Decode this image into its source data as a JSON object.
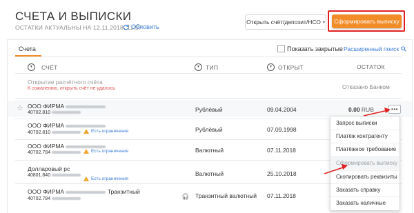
{
  "header": {
    "title": "СЧЕТА И ВЫПИСКИ",
    "subtitle": "ОСТАТКИ АКТУАЛЬНЫ НА 12.11.2018, 11:57",
    "refresh_label": "Обновить",
    "open_select_label": "Открыть счёт/депозит/НСО",
    "primary_button_label": "Сформировать выписку"
  },
  "tabs": {
    "active_label": "Счета"
  },
  "filters": {
    "show_closed_label": "Показать закрытые",
    "show_closed_checked": false,
    "advanced_search_label": "Расширенный поиск"
  },
  "columns": {
    "account": "СЧЁТ",
    "type": "ТИП",
    "opened": "ОТКРЫТ",
    "balance": "ОСТАТОК"
  },
  "pending": {
    "name": "Открытие расчётного счёта",
    "note": "К сожалению, открыть счёт не удалось",
    "status": "Отказано Банком"
  },
  "rows": [
    {
      "name": "ООО ФИРМА",
      "number": "40702.810",
      "restriction": "",
      "type": "Рублёвый",
      "date": "09.04.2004",
      "balance": "0.00",
      "currency": "RUB"
    },
    {
      "name": "ООО ФИРМА",
      "number": "40702.810",
      "restriction": "Есть ограничения",
      "type": "Рублёвый",
      "date": "07.09.1998",
      "balance": "",
      "currency": ""
    },
    {
      "name": "ООО ФИРМА",
      "number": "40702.784",
      "restriction": "Есть ограничения",
      "type": "Валютный",
      "date": "07.11.2018",
      "balance": "",
      "currency": ""
    },
    {
      "name": "Долларовый рс",
      "number": "40801.840",
      "restriction": "Есть ограничения",
      "type": "Валютный",
      "date": "25.10.2018",
      "balance": "",
      "currency": ""
    },
    {
      "name": "ООО ФИРМА",
      "name_suffix": "Транзитный",
      "number": "40702.784",
      "restriction": "",
      "type": "Транзитный валютный",
      "date": "07.11.2018",
      "balance": "",
      "currency": ""
    }
  ],
  "context_menu": {
    "items": [
      {
        "label": "Запрос выписки",
        "disabled": false
      },
      {
        "label": "Платёж контрагенту",
        "disabled": false
      },
      {
        "label": "Платёжное требование",
        "disabled": false
      },
      {
        "label": "Сформировать выписку",
        "disabled": true
      },
      {
        "label": "Скопировать реквизиты",
        "disabled": false
      },
      {
        "label": "Заказать справку",
        "disabled": false
      },
      {
        "label": "Заказать наличные",
        "disabled": false
      }
    ]
  },
  "colors": {
    "accent": "#f28c28",
    "link": "#3a7bd5",
    "annotation": "#e02020",
    "error": "#e05050",
    "warning": "#f2a531"
  },
  "icons": [
    "refresh-icon",
    "chevron-down-icon",
    "search-icon",
    "sort-icon",
    "star-icon",
    "warning-icon",
    "more-icon",
    "headset-icon",
    "arrow-annotation"
  ]
}
